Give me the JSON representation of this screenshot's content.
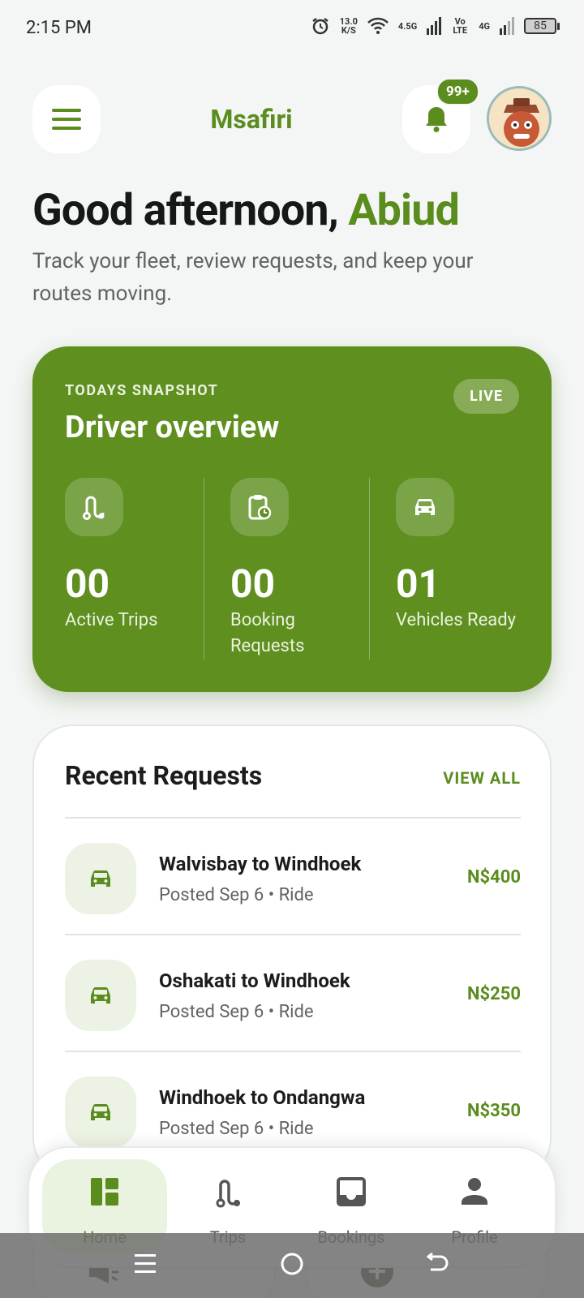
{
  "status_bar": {
    "time": "2:15 PM",
    "net_speed": "13.0",
    "net_unit": "K/S",
    "net1": "4.5G",
    "volte": "Vo LTE",
    "net2": "4G",
    "battery": "85"
  },
  "header": {
    "app_title": "Msafiri",
    "notification_badge": "99+"
  },
  "greeting": {
    "prefix": "Good afternoon, ",
    "name": "Abiud",
    "subtitle": "Track your fleet, review requests, and keep your routes moving."
  },
  "snapshot": {
    "kicker": "TODAYS SNAPSHOT",
    "title": "Driver overview",
    "live_label": "LIVE",
    "stats": [
      {
        "value": "00",
        "label": "Active Trips",
        "icon": "route-icon"
      },
      {
        "value": "00",
        "label": "Booking Requests",
        "icon": "clipboard-clock-icon"
      },
      {
        "value": "01",
        "label": "Vehicles Ready",
        "icon": "car-icon"
      }
    ]
  },
  "recent_requests": {
    "title": "Recent Requests",
    "view_all": "VIEW ALL",
    "items": [
      {
        "route": "Walvisbay to Windhoek",
        "meta": "Posted Sep 6 • Ride",
        "price": "N$400"
      },
      {
        "route": "Oshakati to Windhoek",
        "meta": "Posted Sep 6 • Ride",
        "price": "N$250"
      },
      {
        "route": "Windhoek to Ondangwa",
        "meta": "Posted Sep 6 • Ride",
        "price": "N$350"
      }
    ]
  },
  "bottom_nav": {
    "items": [
      {
        "label": "Home",
        "icon": "dashboard-icon",
        "active": true
      },
      {
        "label": "Trips",
        "icon": "route-icon",
        "active": false
      },
      {
        "label": "Bookings",
        "icon": "inbox-icon",
        "active": false
      },
      {
        "label": "Profile",
        "icon": "person-icon",
        "active": false
      }
    ]
  },
  "colors": {
    "primary": "#5b8c1e",
    "snapshot_bg": "#5f8f1f",
    "background": "#f3f6f4"
  }
}
